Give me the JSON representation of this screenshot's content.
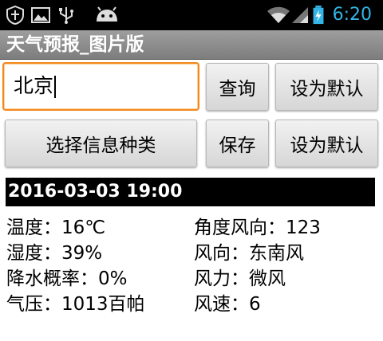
{
  "status_bar": {
    "time": "6:20",
    "icons": [
      "shield-notification-icon",
      "image-notification-icon",
      "usb-icon",
      "android-icon",
      "wifi-icon",
      "signal-icon",
      "battery-charging-icon"
    ]
  },
  "app": {
    "title": "天气预报_图片版"
  },
  "search": {
    "city_value": "北京"
  },
  "buttons": {
    "query": "查询",
    "set_default_1": "设为默认",
    "select_info_type": "选择信息种类",
    "save": "保存",
    "set_default_2": "设为默认"
  },
  "weather": {
    "datetime": "2016-03-03 19:00",
    "left": [
      "温度：16℃",
      "湿度：39%",
      "降水概率：0%",
      "气压：1013百帕"
    ],
    "right": [
      "角度风向：123",
      "风向：东南风",
      "风力：微风",
      "风速：6"
    ]
  },
  "colors": {
    "time": "#33b5e5",
    "input_focus": "#f08a1c",
    "titlebar": "#8a8a8a"
  }
}
